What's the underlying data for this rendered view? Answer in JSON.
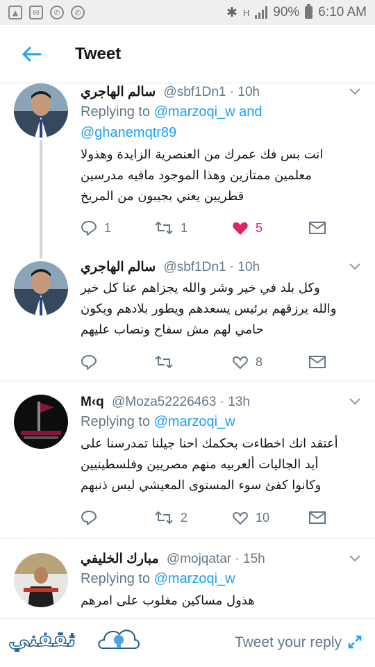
{
  "status_bar": {
    "battery": "90%",
    "time": "6:10 AM",
    "network": "H"
  },
  "header": {
    "title": "Tweet"
  },
  "tweets": [
    {
      "name": "سالم الهاجري",
      "handle": "@sbf1Dn1",
      "time": "· 10h",
      "replying_label": "Replying to",
      "replying_line1": "@marzoqi_w and",
      "replying_line2": "@ghanemqtr89",
      "lines": [
        "انت بس فك عمرك من العنصرية الزايدة وهذولا",
        "معلمين ممتازين وهذا الموجود مافيه مدرسين",
        "قطريين يعني بجيبون من المريخ"
      ],
      "replies": "1",
      "retweets": "1",
      "likes": "5"
    },
    {
      "name": "سالم الهاجري",
      "handle": "@sbf1Dn1",
      "time": "· 10h",
      "lines": [
        "وكل بلد في خير وشر والله يجزاهم عنا كل خير",
        "والله يرزقهم برئيس يسعدهم ويطور بلادهم ويكون",
        "حامي لهم مش سفاح ونصاب عليهم"
      ],
      "replies": "",
      "retweets": "",
      "likes": "8"
    },
    {
      "name": "M‹q",
      "handle": "@Moza52226463",
      "time": "· 13h",
      "replying_label": "Replying to",
      "replying_line1": "@marzoqi_w",
      "lines": [
        "أعتقد انك اخطاءت بحكمك احنا جيلنا تمدرسنا على",
        "أيد الجاليات ألعربيه منهم مصريين وفلسطينيين",
        "وكانوا كفئ   سوء المستوى المعيشي ليس ذنبهم"
      ],
      "replies": "",
      "retweets": "2",
      "likes": "10"
    },
    {
      "name": "مبارك الخليفي",
      "handle": "@mojqatar",
      "time": "· 15h",
      "replying_label": "Replying to",
      "replying_line1": "@marzoqi_w",
      "lines": [
        "هذول مساكين مغلوب على امرهم"
      ]
    }
  ],
  "bottom": {
    "brand": "ثقفني",
    "reply_placeholder": "Tweet your reply"
  },
  "colors": {
    "accent": "#1da1f2",
    "like": "#e0245e",
    "muted": "#657786"
  }
}
